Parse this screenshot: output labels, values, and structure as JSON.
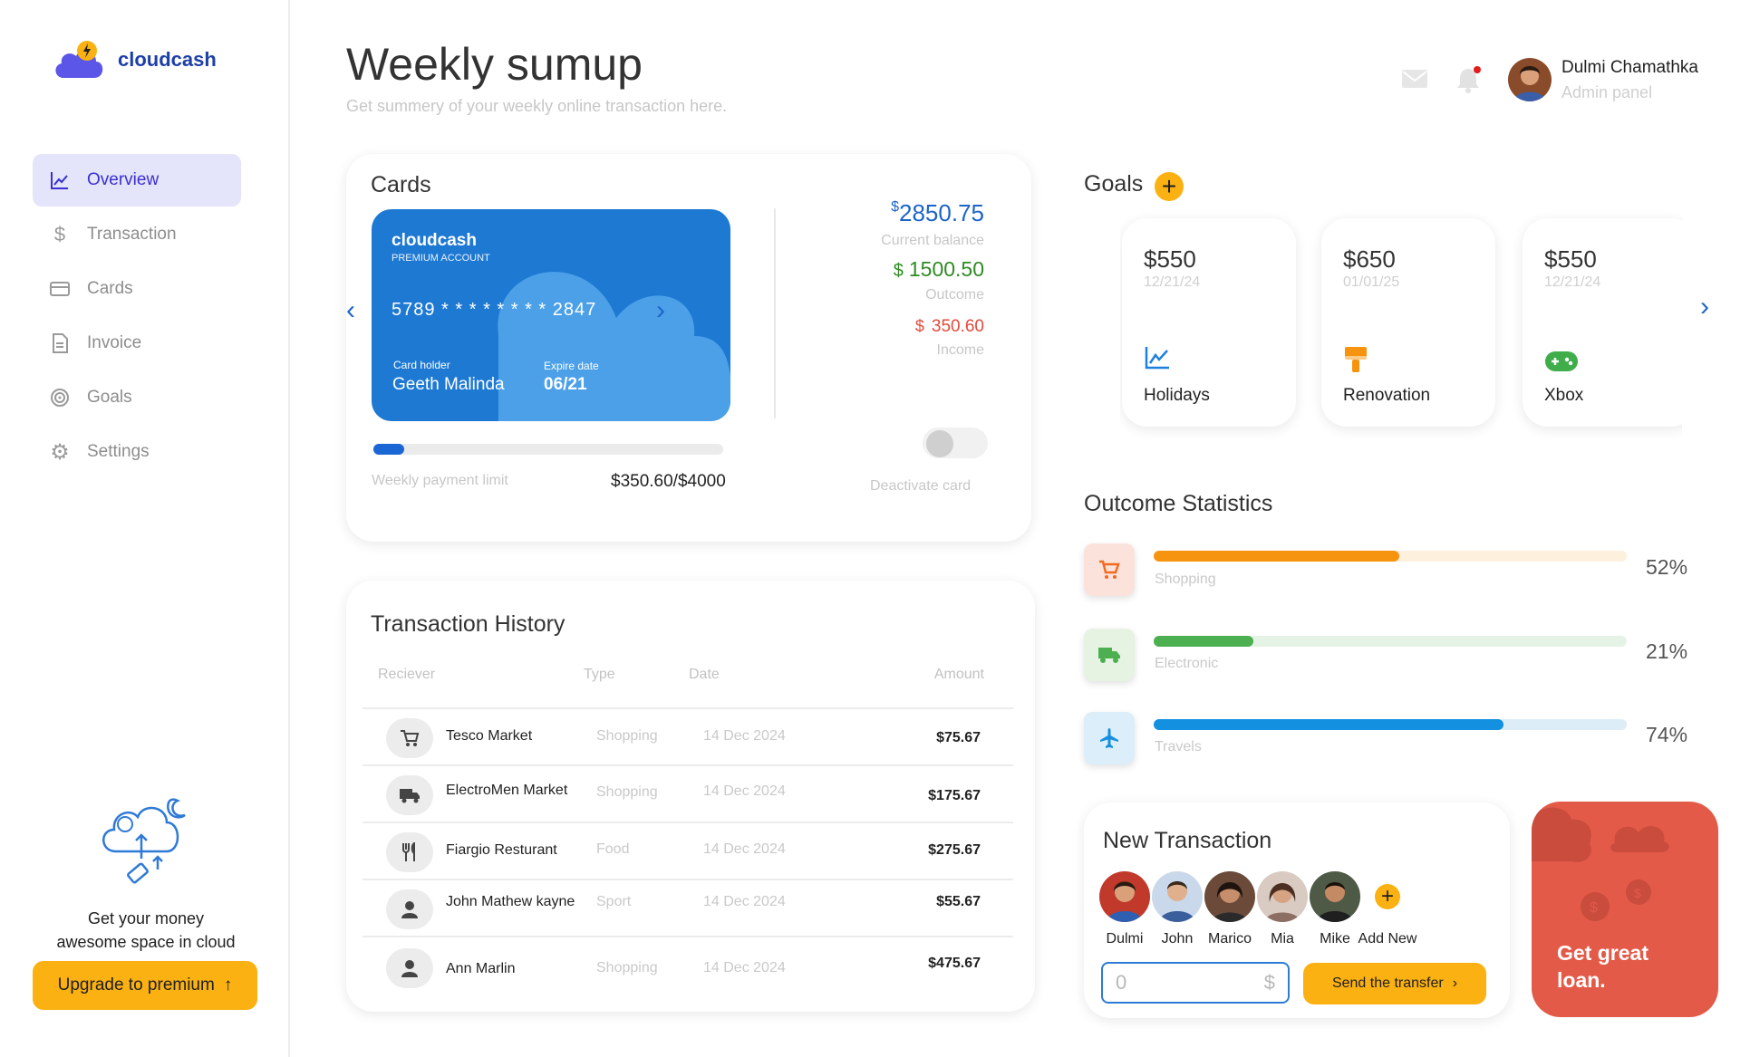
{
  "brand": {
    "name": "cloudcash"
  },
  "sidebar": {
    "items": [
      {
        "label": "Overview",
        "icon": "chart-line-icon",
        "active": true
      },
      {
        "label": "Transaction",
        "icon": "dollar-icon"
      },
      {
        "label": "Cards",
        "icon": "card-icon"
      },
      {
        "label": "Invoice",
        "icon": "document-icon"
      },
      {
        "label": "Goals",
        "icon": "target-icon"
      },
      {
        "label": "Settings",
        "icon": "gear-icon"
      }
    ],
    "promo": {
      "line1": "Get your money",
      "line2": "awesome space in cloud",
      "button": "Upgrade to premium"
    }
  },
  "header": {
    "title": "Weekly sumup",
    "subtitle": "Get summery of your weekly online transaction here.",
    "user": {
      "name": "Dulmi Chamathka",
      "role": "Admin panel"
    }
  },
  "cards": {
    "title": "Cards",
    "card": {
      "brand": "cloudcash",
      "account_type": "PREMIUM ACCOUNT",
      "number": "5789 * * * *  * * * *  2847",
      "holder_label": "Card holder",
      "holder": "Geeth Malinda",
      "expire_label": "Expire date",
      "expire": "06/21"
    },
    "limit": {
      "label": "Weekly payment limit",
      "value": "$350.60/$4000",
      "fraction": 0.0877
    },
    "balance": {
      "currency": "$",
      "value": "2850.75",
      "label": "Current balance"
    },
    "outcome": {
      "currency": "$",
      "value": "1500.50",
      "label": "Outcome"
    },
    "income": {
      "currency": "$",
      "value": "350.60",
      "label": "Income"
    },
    "deactivate_label": "Deactivate card",
    "deactivated": false,
    "colors": {
      "card": "#1e79d3",
      "outcome": "#2e8b22",
      "income": "#e24a3b",
      "balance": "#1d64c8"
    }
  },
  "transactions": {
    "title": "Transaction History",
    "columns": [
      "Reciever",
      "Type",
      "Date",
      "Amount"
    ],
    "rows": [
      {
        "receiver": "Tesco Market",
        "type": "Shopping",
        "date": "14 Dec 2024",
        "amount": "$75.67",
        "icon": "cart-icon"
      },
      {
        "receiver": "ElectroMen Market",
        "type": "Shopping",
        "date": "14 Dec 2024",
        "amount": "$175.67",
        "icon": "truck-icon"
      },
      {
        "receiver": "Fiargio Resturant",
        "type": "Food",
        "date": "14 Dec 2024",
        "amount": "$275.67",
        "icon": "cutlery-icon"
      },
      {
        "receiver": "John Mathew kayne",
        "type": "Sport",
        "date": "14 Dec 2024",
        "amount": "$55.67",
        "icon": "person-icon"
      },
      {
        "receiver": "Ann Marlin",
        "type": "Shopping",
        "date": "14 Dec 2024",
        "amount": "$475.67",
        "icon": "person-icon"
      }
    ]
  },
  "goals": {
    "title": "Goals",
    "add_label": "+",
    "items": [
      {
        "amount": "$550",
        "date": "12/21/24",
        "label": "Holidays",
        "icon": "chart-line-icon"
      },
      {
        "amount": "$650",
        "date": "01/01/25",
        "label": "Renovation",
        "icon": "paint-brush-icon"
      },
      {
        "amount": "$550",
        "date": "12/21/24",
        "label": "Xbox",
        "icon": "gamepad-icon"
      }
    ]
  },
  "outcome_stats": {
    "title": "Outcome Statistics",
    "items": [
      {
        "label": "Shopping",
        "percent_label": "52%",
        "fraction": 0.52,
        "icon": "cart-icon",
        "color": "#f7940f",
        "track": "#fdf0dd",
        "bg": "#fbe3dc"
      },
      {
        "label": "Electronic",
        "percent_label": "21%",
        "fraction": 0.21,
        "icon": "truck-icon",
        "color": "#4caf50",
        "track": "#e5f3e6",
        "bg": "#e6f2e2"
      },
      {
        "label": "Travels",
        "percent_label": "74%",
        "fraction": 0.74,
        "icon": "plane-icon",
        "color": "#1490e0",
        "track": "#dcedf8",
        "bg": "#dbeef9"
      }
    ]
  },
  "new_transaction": {
    "title": "New Transaction",
    "contacts": [
      "Dulmi",
      "John",
      "Marico",
      "Mia",
      "Mike"
    ],
    "add_new": "Add New",
    "amount_value": "0",
    "currency": "$",
    "send_label": "Send the transfer"
  },
  "loan": {
    "text": "Get great loan.",
    "color": "#e35a49"
  }
}
